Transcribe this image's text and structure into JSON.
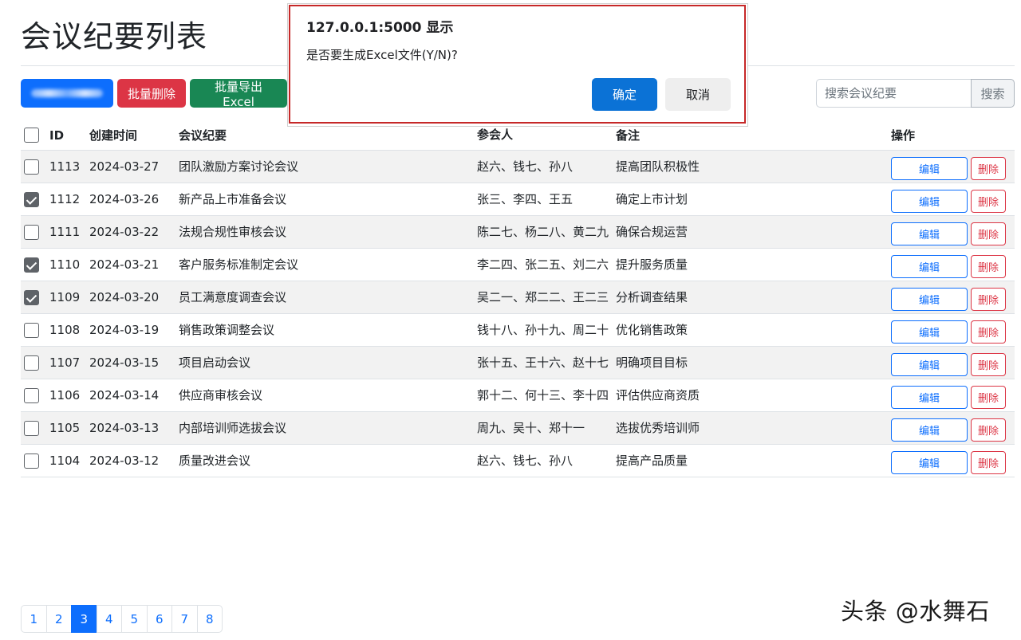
{
  "page": {
    "title": "会议纪要列表"
  },
  "toolbar": {
    "add_label": "",
    "batch_delete_label": "批量删除",
    "batch_export_label": "批量导出Excel"
  },
  "search": {
    "placeholder": "搜索会议纪要",
    "button_label": "搜索"
  },
  "table": {
    "headers": {
      "id": "ID",
      "created": "创建时间",
      "title": "会议纪要",
      "participants": "参会人",
      "note": "备注",
      "ops": "操作"
    },
    "edit_label": "编辑",
    "delete_label": "删除",
    "rows": [
      {
        "checked": false,
        "id": "1113",
        "date": "2024-03-27",
        "title": "团队激励方案讨论会议",
        "participants": "赵六、钱七、孙八",
        "note": "提高团队积极性"
      },
      {
        "checked": true,
        "id": "1112",
        "date": "2024-03-26",
        "title": "新产品上市准备会议",
        "participants": "张三、李四、王五",
        "note": "确定上市计划"
      },
      {
        "checked": false,
        "id": "1111",
        "date": "2024-03-22",
        "title": "法规合规性审核会议",
        "participants": "陈二七、杨二八、黄二九",
        "note": "确保合规运营"
      },
      {
        "checked": true,
        "id": "1110",
        "date": "2024-03-21",
        "title": "客户服务标准制定会议",
        "participants": "李二四、张二五、刘二六",
        "note": "提升服务质量"
      },
      {
        "checked": true,
        "id": "1109",
        "date": "2024-03-20",
        "title": "员工满意度调查会议",
        "participants": "吴二一、郑二二、王二三",
        "note": "分析调查结果"
      },
      {
        "checked": false,
        "id": "1108",
        "date": "2024-03-19",
        "title": "销售政策调整会议",
        "participants": "钱十八、孙十九、周二十",
        "note": "优化销售政策"
      },
      {
        "checked": false,
        "id": "1107",
        "date": "2024-03-15",
        "title": "项目启动会议",
        "participants": "张十五、王十六、赵十七",
        "note": "明确项目目标"
      },
      {
        "checked": false,
        "id": "1106",
        "date": "2024-03-14",
        "title": "供应商审核会议",
        "participants": "郭十二、何十三、李十四",
        "note": "评估供应商资质"
      },
      {
        "checked": false,
        "id": "1105",
        "date": "2024-03-13",
        "title": "内部培训师选拔会议",
        "participants": "周九、吴十、郑十一",
        "note": "选拔优秀培训师"
      },
      {
        "checked": false,
        "id": "1104",
        "date": "2024-03-12",
        "title": "质量改进会议",
        "participants": "赵六、钱七、孙八",
        "note": "提高产品质量"
      }
    ]
  },
  "pagination": {
    "pages": [
      "1",
      "2",
      "3",
      "4",
      "5",
      "6",
      "7",
      "8"
    ],
    "current": 3
  },
  "dialog": {
    "title": "127.0.0.1:5000 显示",
    "message": "是否要生成Excel文件(Y/N)?",
    "ok_label": "确定",
    "cancel_label": "取消"
  },
  "watermark": "头条 @水舞石",
  "colors": {
    "primary": "#0d6efd",
    "danger": "#dc3545",
    "success": "#198754",
    "dialog_border": "#c62828"
  }
}
